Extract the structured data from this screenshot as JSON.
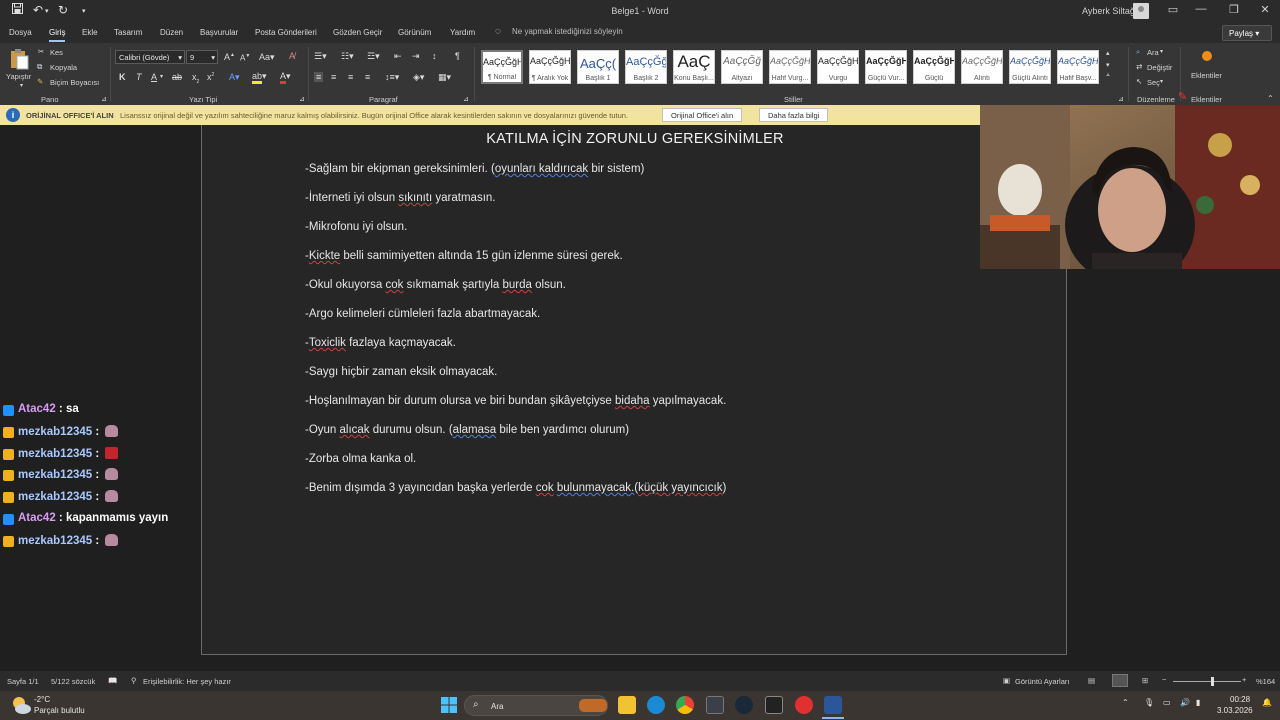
{
  "titlebar": {
    "doc_title": "Belge1 - Word",
    "user_name": "Ayberk Siltağ",
    "quick_access": [
      "save",
      "undo",
      "redo",
      "customize"
    ]
  },
  "tabs": {
    "items": [
      "Dosya",
      "Giriş",
      "Ekle",
      "Tasarım",
      "Düzen",
      "Başvurular",
      "Posta Gönderileri",
      "Gözden Geçir",
      "Görünüm",
      "Yardım"
    ],
    "active": "Giriş",
    "tell_me": "Ne yapmak istediğinizi söyleyin",
    "share": "Paylaş"
  },
  "ribbon": {
    "clipboard": {
      "paste": "Yapıştır",
      "cut": "Kes",
      "copy": "Kopyala",
      "format_painter": "Biçim Boyacısı",
      "label": "Pano"
    },
    "font": {
      "name": "Calibri (Gövde)",
      "size": "9",
      "label": "Yazı Tipi",
      "bold": "K",
      "italic": "T",
      "underline": "A"
    },
    "paragraph": {
      "label": "Paragraf"
    },
    "styles": {
      "label": "Stiller",
      "items": [
        {
          "sample": "AaÇçĞğHı",
          "name": "¶ Normal"
        },
        {
          "sample": "AaÇçĞğHı",
          "name": "¶ Aralık Yok"
        },
        {
          "sample": "AaÇç(",
          "name": "Başlık 1"
        },
        {
          "sample": "AaÇçĞğ",
          "name": "Başlık 2"
        },
        {
          "sample": "AaÇ",
          "name": "Konu Başlı..."
        },
        {
          "sample": "AaÇçĞğ",
          "name": "Altyazı"
        },
        {
          "sample": "AaÇçĞğHı",
          "name": "Hafif Vurg..."
        },
        {
          "sample": "AaÇçĞğHı",
          "name": "Vurgu"
        },
        {
          "sample": "AaÇçĞğHı",
          "name": "Güçlü Vur..."
        },
        {
          "sample": "AaÇçĞğHı",
          "name": "Güçlü"
        },
        {
          "sample": "AaÇçĞğHı",
          "name": "Alıntı"
        },
        {
          "sample": "AaÇçĞğHı",
          "name": "Güçlü Alıntı"
        },
        {
          "sample": "AaÇçĞğHı",
          "name": "Hafif Başv..."
        }
      ]
    },
    "editing": {
      "find": "Ara",
      "replace": "Değiştir",
      "select": "Seç",
      "label": "Düzenleme"
    },
    "addins": {
      "addins": "Eklentiler",
      "label": "Eklentiler"
    }
  },
  "infobar": {
    "title": "ORİJİNAL OFFICE'İ ALIN",
    "message": "Lisanssız orijinal değil ve yazılım sahteciliğine maruz kalmış olabilirsiniz. Bugün orijinal Office alarak kesintilerden sakının ve dosyalarınızı güvende tutun.",
    "button_get": "Orijinal Office'i alın",
    "button_more": "Daha fazla bilgi"
  },
  "document": {
    "heading": "KATILMA İÇİN ZORUNLU GEREKSİNİMLER",
    "lines": [
      "-Sağlam bir ekipman gereksinimleri. (oyunları kaldırıcak bir sistem)",
      "-İnterneti iyi olsun sıkınıtı yaratmasın.",
      "-Mikrofonu iyi olsun.",
      "-Kickte belli samimiyetten altında 15 gün izlenme süresi gerek.",
      "-Okul okuyorsa cok sıkmamak şartıyla burda olsun.",
      "-Argo kelimeleri cümleleri fazla abartmayacak.",
      "-Toxiclik fazlaya kaçmayacak.",
      "-Saygı hiçbir zaman eksik olmayacak.",
      "-Hoşlanılmayan bir durum olursa ve biri bundan şikâyetçiyse bidaha yapılmayacak.",
      "-Oyun alıcak durumu olsun. (alamasa bile ben yardımcı olurum)",
      "-Zorba olma kanka ol.",
      "-Benim dışımda 3 yayıncıdan başka yerlerde cok bulunmayacak.(küçük yayıncıcık)"
    ]
  },
  "chat": [
    {
      "user": "Atac42",
      "message": "sa",
      "color": "#d89cf6",
      "badge": "#1e90ff"
    },
    {
      "user": "mezkab12345",
      "message": "",
      "color": "#a9c8ff",
      "badge": "#f0b020",
      "emote": "pink"
    },
    {
      "user": "mezkab12345",
      "message": "",
      "color": "#a9c8ff",
      "badge": "#f0b020",
      "emote": "red"
    },
    {
      "user": "mezkab12345",
      "message": "",
      "color": "#a9c8ff",
      "badge": "#f0b020",
      "emote": "pink"
    },
    {
      "user": "mezkab12345",
      "message": "",
      "color": "#a9c8ff",
      "badge": "#f0b020",
      "emote": "pink"
    },
    {
      "user": "Atac42",
      "message": "kapanmamıs yayın",
      "color": "#d89cf6",
      "badge": "#1e90ff"
    },
    {
      "user": "mezkab12345",
      "message": "",
      "color": "#a9c8ff",
      "badge": "#f0b020",
      "emote": "pink"
    }
  ],
  "statusbar": {
    "page": "Sayfa 1/1",
    "words": "5/122 sözcük",
    "accessibility": "Erişilebilirlik: Her şey hazır",
    "display_settings": "Görüntü Ayarları",
    "zoom": "%164",
    "zoom_percent": 164
  },
  "taskbar": {
    "weather_temp": "-2°C",
    "weather_desc": "Parçalı bulutlu",
    "search_placeholder": "Ara",
    "time": "00:28",
    "date": "3.03.2026"
  },
  "colors": {
    "infobar_bg": "#f3e3a1",
    "accent": "#a8c4ee",
    "spell_error": "#d04040",
    "grammar_error": "#5080e0"
  }
}
